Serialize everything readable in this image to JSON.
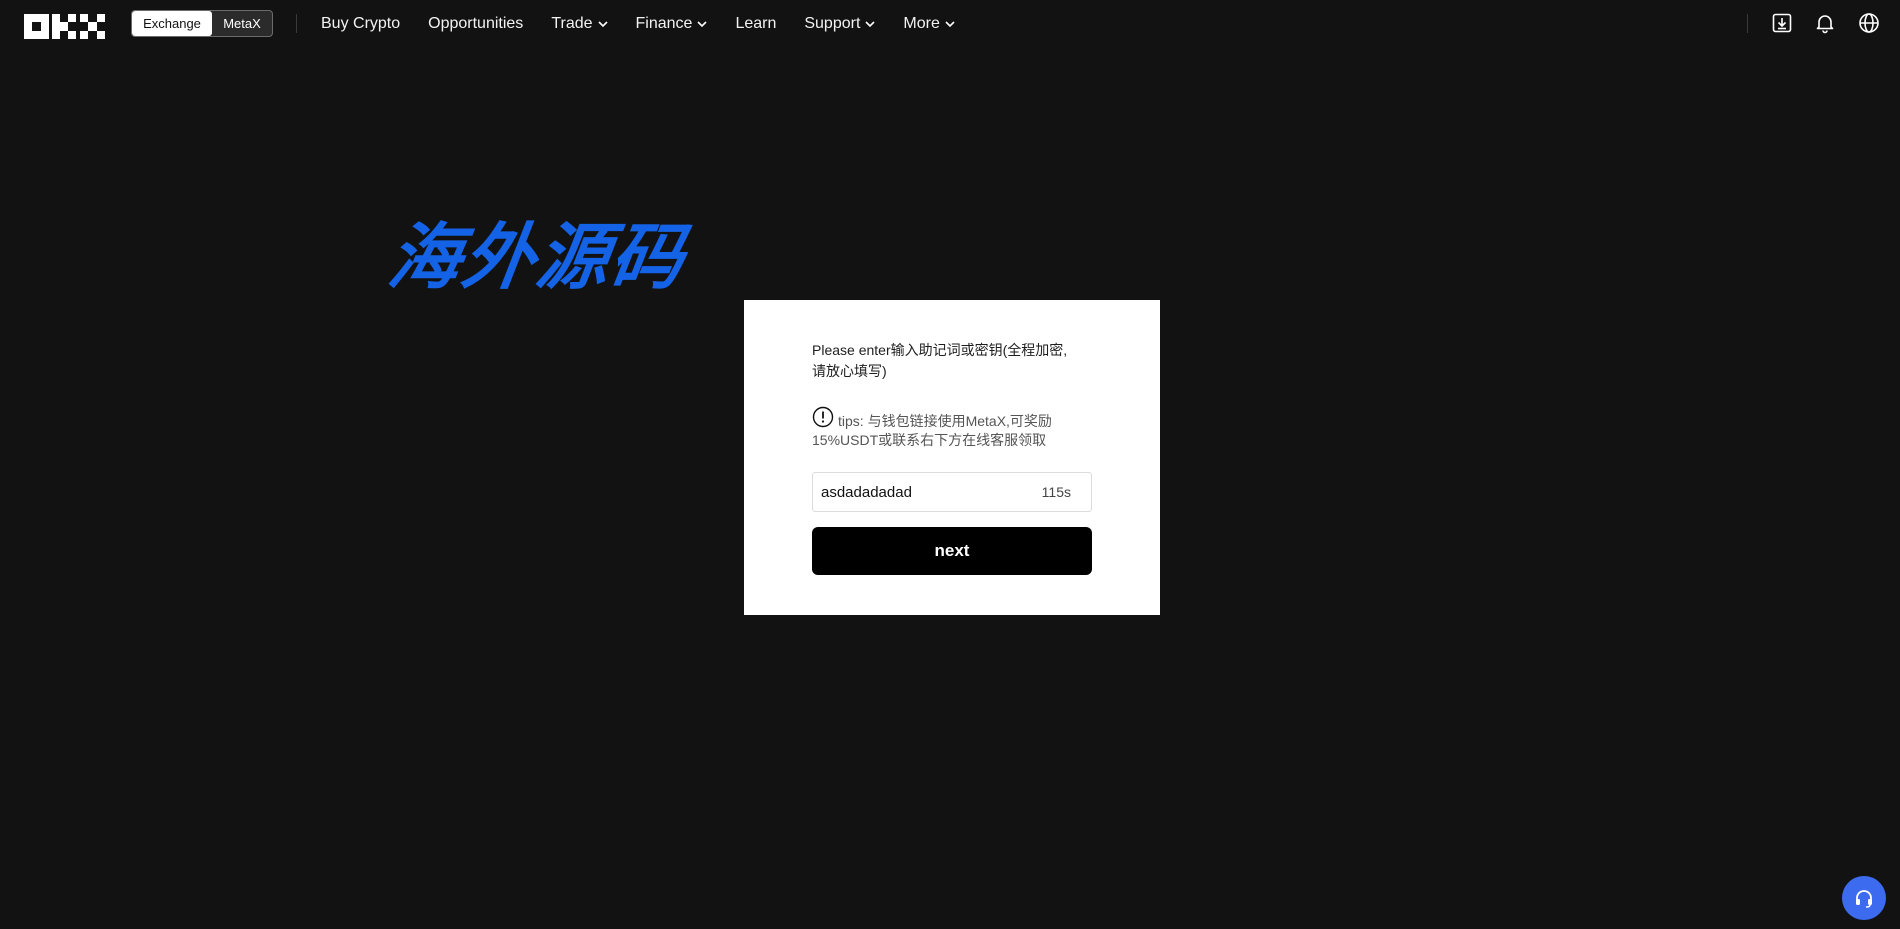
{
  "brand": {
    "logo_icon": "okx-logo-icon"
  },
  "switcher": {
    "exchange_label": "Exchange",
    "metax_label": "MetaX",
    "active": "Exchange"
  },
  "nav": {
    "items": [
      {
        "label": "Buy Crypto",
        "has_dropdown": false
      },
      {
        "label": "Opportunities",
        "has_dropdown": false
      },
      {
        "label": "Trade",
        "has_dropdown": true
      },
      {
        "label": "Finance",
        "has_dropdown": true
      },
      {
        "label": "Learn",
        "has_dropdown": false
      },
      {
        "label": "Support",
        "has_dropdown": true
      },
      {
        "label": "More",
        "has_dropdown": true
      }
    ]
  },
  "header_icons": [
    "download-icon",
    "bell-icon",
    "globe-icon"
  ],
  "watermark": {
    "text": "海外源码",
    "color": "#1463e6"
  },
  "modal": {
    "prompt_line1": "Please enter输入助记词或密钥(全程加密,",
    "prompt_line2": "请放心填写)",
    "tip_line1": "tips: 与钱包链接使用MetaX,可奖励",
    "tip_line2": "15%USDT或联系右下方在线客服领取",
    "input_value": "asdadadadad",
    "timer": "115s",
    "next_label": "next"
  },
  "support_fab": {
    "icon": "headset-icon",
    "color": "#3d6bf0"
  }
}
